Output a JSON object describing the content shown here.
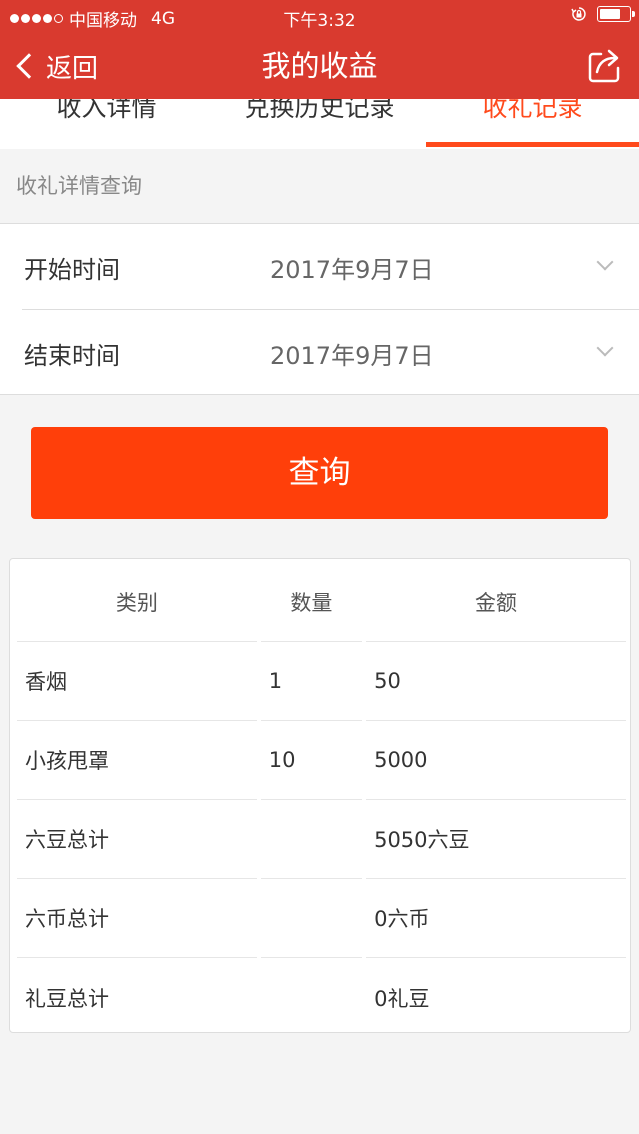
{
  "status_bar": {
    "carrier": "中国移动",
    "network": "4G",
    "time": "下午3:32",
    "battery_level": 0.7
  },
  "nav": {
    "back_label": "返回",
    "title": "我的收益",
    "share_icon": "share-icon"
  },
  "tabs": [
    {
      "label": "收入详情",
      "active": false
    },
    {
      "label": "兑换历史记录",
      "active": false
    },
    {
      "label": "收礼记录",
      "active": true
    }
  ],
  "section_header": "收礼详情查询",
  "date_filter": {
    "start_label": "开始时间",
    "start_value": "2017年9月7日",
    "end_label": "结束时间",
    "end_value": "2017年9月7日"
  },
  "query_button": "查询",
  "table": {
    "headers": [
      "类别",
      "数量",
      "金额"
    ],
    "rows": [
      [
        "香烟",
        "1",
        "50"
      ],
      [
        "小孩甩罩",
        "10",
        "5000"
      ],
      [
        "六豆总计",
        "",
        "5050六豆"
      ],
      [
        "六币总计",
        "",
        "0六币"
      ],
      [
        "礼豆总计",
        "",
        "0礼豆"
      ]
    ]
  },
  "colors": {
    "nav_red": "#d93a2f",
    "accent_orange": "#ff3f0a",
    "tab_active": "#ff4a1c"
  }
}
